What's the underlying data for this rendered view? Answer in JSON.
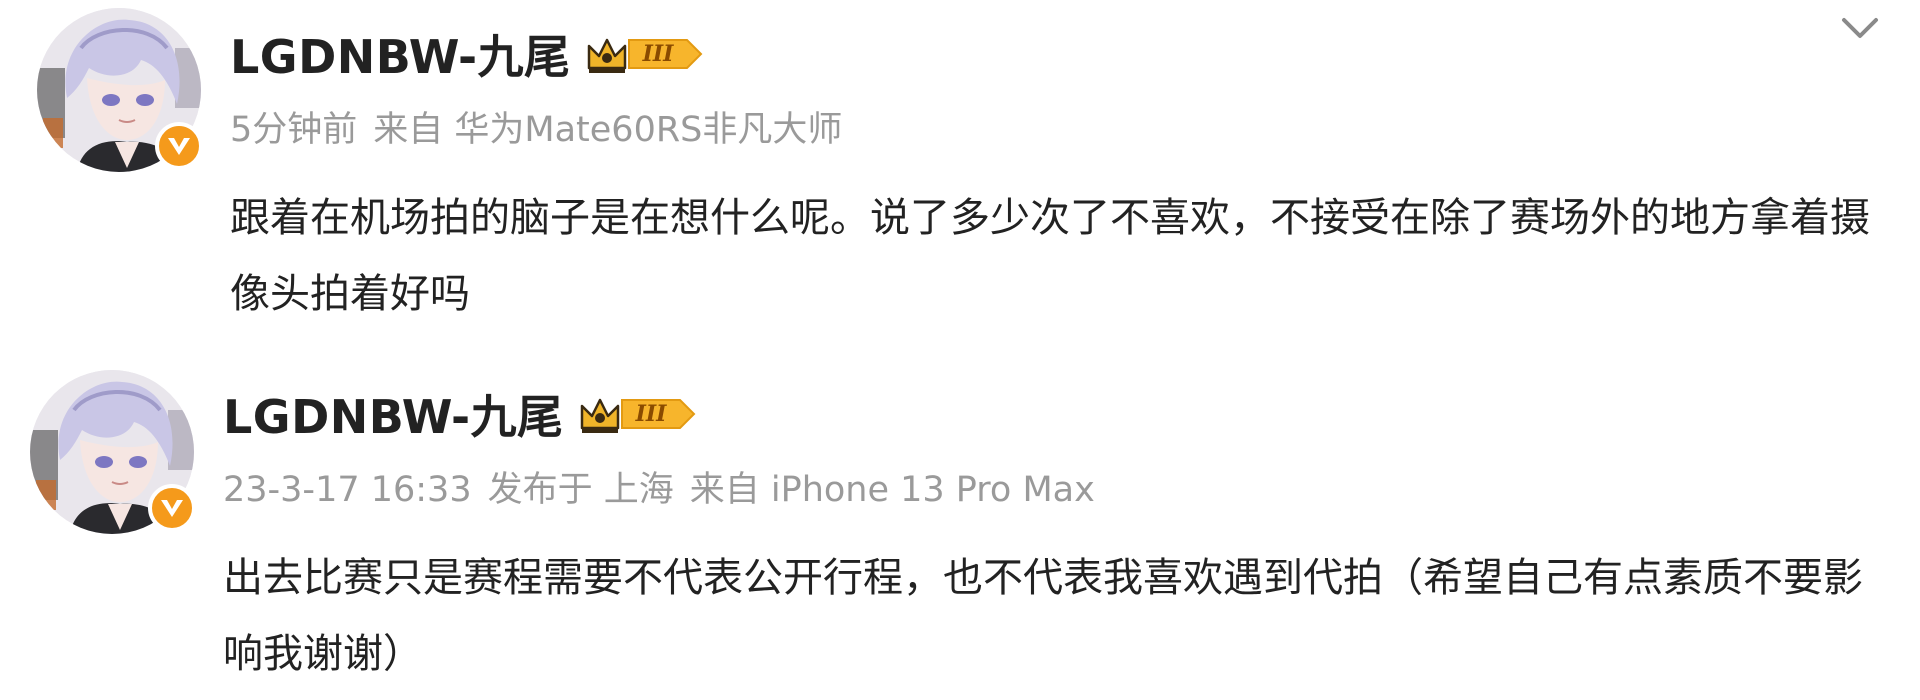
{
  "posts": [
    {
      "username": "LGDNBW-九尾",
      "level": "III",
      "meta": {
        "time": "5分钟前",
        "source": "来自 华为Mate60RS非凡大师"
      },
      "text": "跟着在机场拍的脑子是在想什么呢。说了多少次了不喜欢，不接受在除了赛场外的地方拿着摄像头拍着好吗",
      "avatar_icon": "anime-boy-avatar",
      "badge_icon": "vip-v-badge-icon"
    },
    {
      "username": "LGDNBW-九尾",
      "level": "III",
      "meta": {
        "time": "23-3-17 16:33",
        "location": "发布于 上海",
        "source": "来自 iPhone 13 Pro Max"
      },
      "text": "出去比赛只是赛程需要不代表公开行程，也不代表我喜欢遇到代拍（希望自己有点素质不要影响我谢谢）",
      "avatar_icon": "anime-boy-avatar",
      "badge_icon": "vip-v-badge-icon"
    }
  ],
  "menu_icon": "chevron-down-icon",
  "colors": {
    "name": "#222222",
    "meta": "#9a9a9a",
    "badge_orange": "#f59a1b",
    "crown_gold": "#f0b429"
  }
}
